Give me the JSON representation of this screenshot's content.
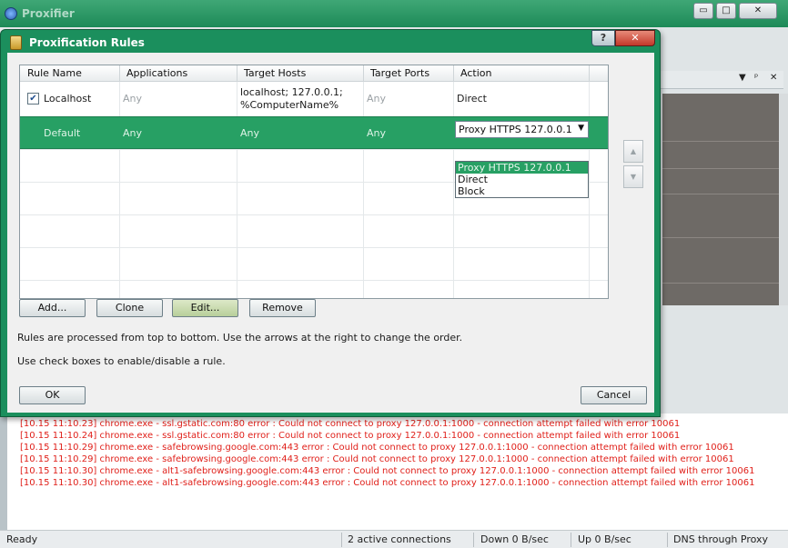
{
  "app": {
    "title": "Proxifier",
    "window_buttons": {
      "minimize": "▭",
      "maximize": "□",
      "close": "✕"
    }
  },
  "right_panel": {
    "pin": "ᵖ",
    "close": "✕",
    "dropdown": "▼"
  },
  "dialog": {
    "title": "Proxification Rules",
    "help_label": "?",
    "close_label": "✕",
    "columns": [
      "Rule Name",
      "Applications",
      "Target Hosts",
      "Target Ports",
      "Action"
    ],
    "rules": [
      {
        "name": "Localhost",
        "checked": true,
        "check_mark": "✔",
        "applications": "Any",
        "target_hosts_line1": "localhost; 127.0.0.1;",
        "target_hosts_line2": "%ComputerName%",
        "target_ports": "Any",
        "action": "Direct"
      },
      {
        "name": "Default",
        "applications": "Any",
        "target_hosts": "Any",
        "target_ports": "Any",
        "action": "Proxy HTTPS 127.0.0.1"
      }
    ],
    "action_dropdown": {
      "arrow": "▼",
      "options": [
        "Proxy HTTPS 127.0.0.1",
        "Direct",
        "Block"
      ],
      "selected": "Proxy HTTPS 127.0.0.1"
    },
    "move_up": "▲",
    "move_down": "▼",
    "buttons": {
      "add": "Add...",
      "clone": "Clone",
      "edit": "Edit...",
      "remove": "Remove",
      "ok": "OK",
      "cancel": "Cancel"
    },
    "info_order": "Rules are processed from top to bottom. Use the arrows at the right to change the order.",
    "info_checkbox": "Use check boxes to enable/disable a rule."
  },
  "log": [
    "[10.15 11:10.23] chrome.exe - ssl.gstatic.com:80 error : Could not connect to proxy 127.0.0.1:1000 - connection attempt failed with error 10061",
    "[10.15 11:10.24] chrome.exe - ssl.gstatic.com:80 error : Could not connect to proxy 127.0.0.1:1000 - connection attempt failed with error 10061",
    "[10.15 11:10.29] chrome.exe - safebrowsing.google.com:443 error : Could not connect to proxy 127.0.0.1:1000 - connection attempt failed with error 10061",
    "[10.15 11:10.29] chrome.exe - safebrowsing.google.com:443 error : Could not connect to proxy 127.0.0.1:1000 - connection attempt failed with error 10061",
    "[10.15 11:10.30] chrome.exe - alt1-safebrowsing.google.com:443 error : Could not connect to proxy 127.0.0.1:1000 - connection attempt failed with error 10061",
    "[10.15 11:10.30] chrome.exe - alt1-safebrowsing.google.com:443 error : Could not connect to proxy 127.0.0.1:1000 - connection attempt failed with error 10061"
  ],
  "status": {
    "ready": "Ready",
    "connections": "2 active connections",
    "down": "Down 0 B/sec",
    "up": "Up 0 B/sec",
    "dns": "DNS through Proxy"
  }
}
